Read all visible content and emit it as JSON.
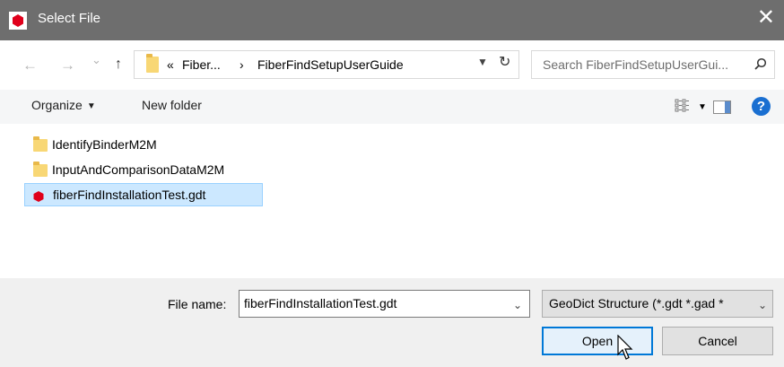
{
  "titlebar": {
    "title": "Select File",
    "app_icon": "geodict-red-icon",
    "close_icon": "close-icon",
    "close_glyph": "✕"
  },
  "nav": {
    "back_glyph": "←",
    "forward_glyph": "→",
    "recent_glyph": "⌄",
    "up_glyph": "↑"
  },
  "address": {
    "overflow": "«",
    "crumbs": [
      "Fiber...",
      "FiberFindSetupUserGuide"
    ],
    "separator": "›",
    "refresh_glyph": "↻"
  },
  "search": {
    "placeholder": "Search FiberFindSetupUserGui..."
  },
  "toolbar": {
    "organize_label": "Organize",
    "new_folder_label": "New folder",
    "help_glyph": "?"
  },
  "files": [
    {
      "name": "IdentifyBinderM2M",
      "type": "folder",
      "selected": false
    },
    {
      "name": "InputAndComparisonDataM2M",
      "type": "folder",
      "selected": false
    },
    {
      "name": "fiberFindInstallationTest.gdt",
      "type": "gdt",
      "selected": true
    }
  ],
  "footer": {
    "filename_label": "File name:",
    "filename_value": "fiberFindInstallationTest.gdt",
    "filetype_value": "GeoDict Structure (*.gdt *.gad *",
    "open_label": "Open",
    "cancel_label": "Cancel"
  },
  "colors": {
    "titlebar": "#6e6e6e",
    "selection": "#cce8ff",
    "accent": "#0078d7",
    "app_red": "#e0001b"
  }
}
